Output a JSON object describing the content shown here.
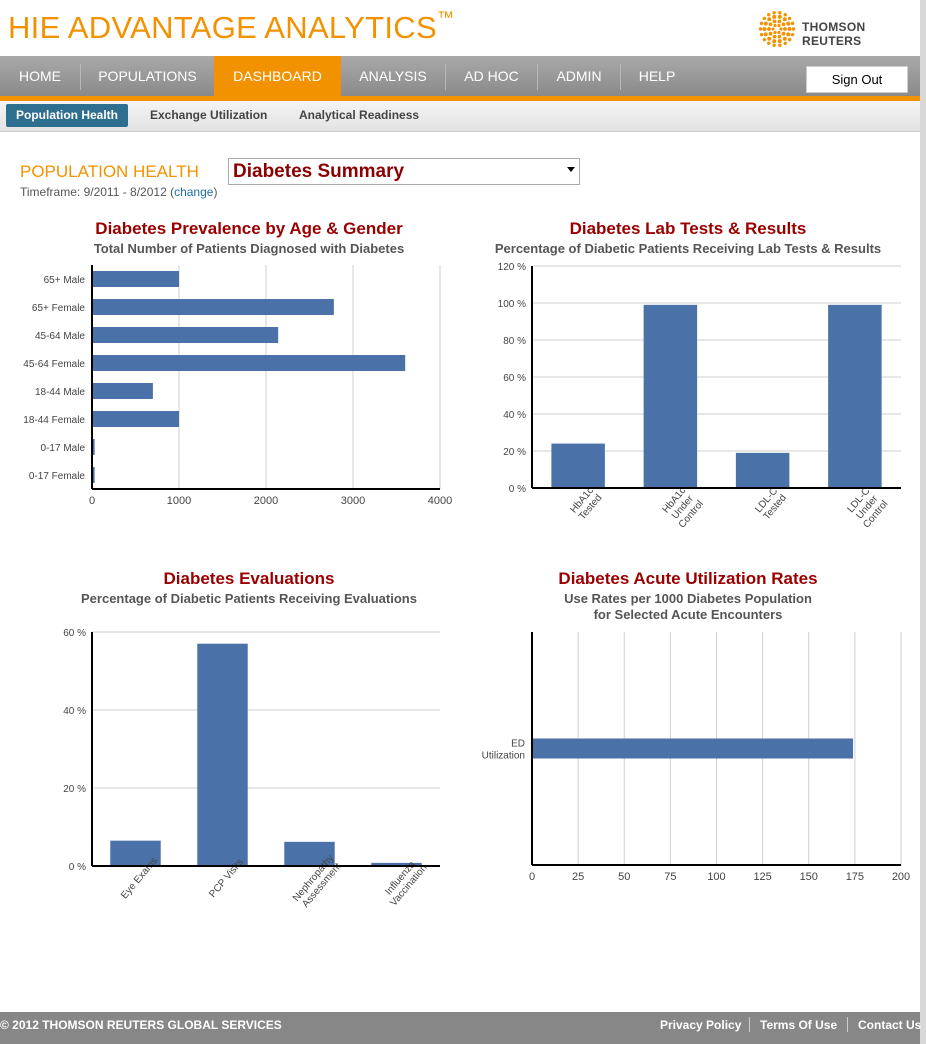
{
  "header": {
    "brand_title": "HIE ADVANTAGE ANALYTICS",
    "brand_tm": "™",
    "logo_text": "THOMSON REUTERS"
  },
  "nav": {
    "items": [
      {
        "label": "HOME"
      },
      {
        "label": "POPULATIONS"
      },
      {
        "label": "DASHBOARD",
        "active": true
      },
      {
        "label": "ANALYSIS"
      },
      {
        "label": "AD HOC"
      },
      {
        "label": "ADMIN"
      },
      {
        "label": "HELP"
      }
    ],
    "sign_out": "Sign Out"
  },
  "subnav": {
    "tabs": [
      {
        "label": "Population Health",
        "active": true
      },
      {
        "label": "Exchange Utilization"
      },
      {
        "label": "Analytical Readiness"
      }
    ]
  },
  "page": {
    "title": "POPULATION HEALTH",
    "timeframe_prefix": "Timeframe: 9/2011 - 8/2012 (",
    "timeframe_link": "change",
    "timeframe_suffix": ")",
    "report_select": "Diabetes Summary"
  },
  "colors": {
    "accent": "#f39200",
    "bar": "#4a72a8",
    "title": "#9a0000"
  },
  "chart_data": [
    {
      "type": "bar",
      "orientation": "horizontal",
      "title": "Diabetes Prevalence by Age & Gender",
      "subtitle": "Total Number of Patients Diagnosed with Diabetes",
      "categories": [
        "65+ Male",
        "65+ Female",
        "45-64 Male",
        "45-64 Female",
        "18-44 Male",
        "18-44 Female",
        "0-17 Male",
        "0-17 Female"
      ],
      "values": [
        1000,
        2780,
        2140,
        3600,
        700,
        1000,
        30,
        30
      ],
      "xlim": [
        0,
        4000
      ],
      "ticks": [
        "0",
        "1000",
        "2000",
        "3000",
        "4000"
      ],
      "grid": true
    },
    {
      "type": "bar",
      "title": "Diabetes Lab Tests & Results",
      "subtitle": "Percentage of Diabetic Patients Receiving Lab Tests & Results",
      "categories": [
        "HbA1c\nTested",
        "HbA1c\nUnder\nControl",
        "LDL-C\nTested",
        "LDL-C\nUnder\nControl"
      ],
      "values": [
        24,
        99,
        19,
        99
      ],
      "ylim": [
        0,
        120
      ],
      "ticks": [
        "0 %",
        "20 %",
        "40 %",
        "60 %",
        "80 %",
        "100 %",
        "120 %"
      ],
      "grid": true
    },
    {
      "type": "bar",
      "title": "Diabetes Evaluations",
      "subtitle": "Percentage of Diabetic Patients Receiving Evaluations",
      "categories": [
        "Eye Exams",
        "PCP Visits",
        "Nephropathy\nAssessment",
        "Influenza\nVaccination"
      ],
      "values": [
        6.5,
        57,
        6.2,
        0.8
      ],
      "ylim": [
        0,
        60
      ],
      "ticks": [
        "0 %",
        "20 %",
        "40 %",
        "60 %"
      ],
      "grid": true
    },
    {
      "type": "bar",
      "orientation": "horizontal",
      "title": "Diabetes Acute Utilization Rates",
      "subtitle": "Use Rates per 1000 Diabetes Population\nfor Selected Acute Encounters",
      "categories": [
        "ED\nUtilization"
      ],
      "values": [
        174
      ],
      "xlim": [
        0,
        200
      ],
      "ticks": [
        "0",
        "25",
        "50",
        "75",
        "100",
        "125",
        "150",
        "175",
        "200"
      ],
      "grid": true
    }
  ],
  "footer": {
    "copyright": "© 2012 THOMSON REUTERS GLOBAL SERVICES",
    "links": [
      "Privacy Policy",
      "Terms Of Use",
      "Contact Us"
    ]
  }
}
